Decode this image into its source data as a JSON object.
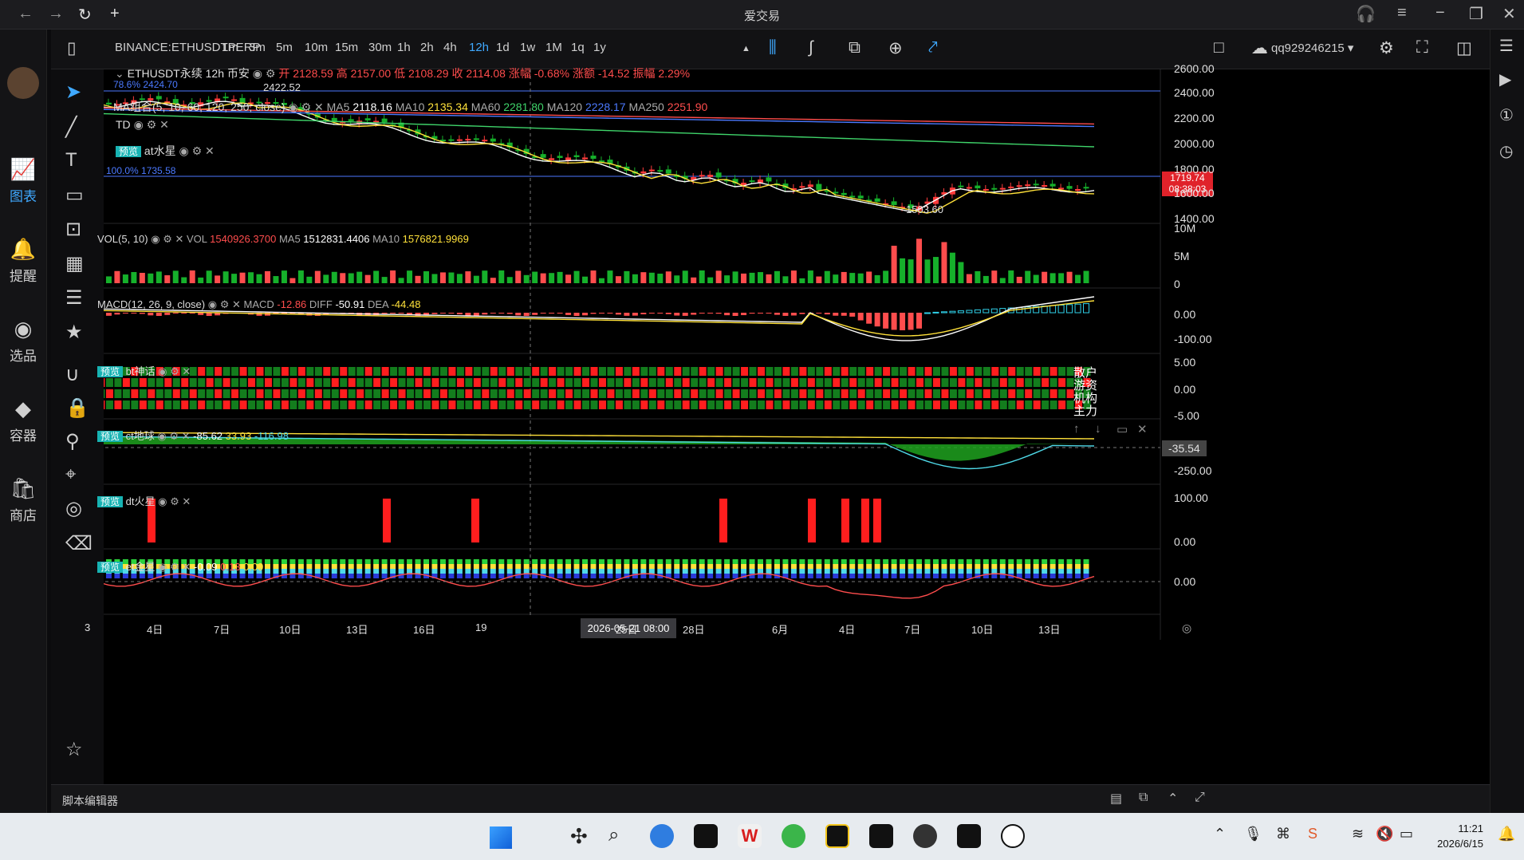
{
  "window": {
    "title": "爱交易"
  },
  "leftnav": [
    {
      "label": "图表",
      "icon": "chart-icon",
      "active": true
    },
    {
      "label": "提醒",
      "icon": "bell-icon",
      "active": false
    },
    {
      "label": "选品",
      "icon": "analytics-icon",
      "active": false
    },
    {
      "label": "容器",
      "icon": "container-icon",
      "active": false
    },
    {
      "label": "商店",
      "icon": "shop-icon",
      "active": false
    }
  ],
  "toolbar": {
    "symbol": "BINANCE:ETHUSDTPERP",
    "intervals": [
      "1m",
      "3m",
      "5m",
      "10m",
      "15m",
      "30m",
      "1h",
      "2h",
      "4h",
      "12h",
      "1d",
      "1w",
      "1M",
      "1q",
      "1y"
    ],
    "active_interval": "12h",
    "user": "qq929246215"
  },
  "main_legend": {
    "title": "ETHUSDT永续  12h  币安",
    "ohlc": "开 2128.59 高 2157.00 低 2108.29 收 2114.08 涨幅 -0.68% 涨额 -14.52 振幅 2.29%",
    "fib_top": "78.6% 2424.70",
    "high_label": "2422.52",
    "fib_mid": "100.0% 1735.58",
    "low_label": "1503.60",
    "price_tag": "1719.74",
    "countdown": "08:38:03"
  },
  "ma_legend": {
    "name": "MA组合(5, 10, 60, 120, 250, close)",
    "items": [
      {
        "k": "MA5",
        "v": "2118.16",
        "color": "#ffffff"
      },
      {
        "k": "MA10",
        "v": "2135.34",
        "color": "#ffe13a"
      },
      {
        "k": "MA60",
        "v": "2281.80",
        "color": "#3fd46a"
      },
      {
        "k": "MA120",
        "v": "2228.17",
        "color": "#4b79ff"
      },
      {
        "k": "MA250",
        "v": "2251.90",
        "color": "#ff4d4d"
      }
    ]
  },
  "td_legend": "TD",
  "at_legend": {
    "badge": "预览",
    "name": "at水星"
  },
  "price_axis": [
    "2600.00",
    "2400.00",
    "2200.00",
    "2000.00",
    "1800.00",
    "1600.00",
    "1400.00"
  ],
  "vol": {
    "name": "VOL(5, 10)",
    "vol": "1540926.3700",
    "ma5": "1512831.4406",
    "ma10": "1576821.9969",
    "axis": [
      "10M",
      "5M",
      "0"
    ]
  },
  "macd": {
    "name": "MACD(12, 26, 9, close)",
    "macd": "-12.86",
    "diff": "-50.91",
    "dea": "-44.48",
    "axis": [
      "0.00",
      "-100.00"
    ]
  },
  "bt": {
    "badge": "预览",
    "name": "bt神话",
    "axis": [
      "5.00",
      "0.00",
      "-5.00"
    ],
    "labels": [
      "散户",
      "游资",
      "机构",
      "主力"
    ]
  },
  "ct": {
    "badge": "预览",
    "name": "ct地球",
    "v1": "-85.62",
    "v2": "33.93",
    "v3": "-116.98",
    "axis": [
      "-35.54",
      "-250.00"
    ]
  },
  "dt": {
    "badge": "预览",
    "name": "dt火星",
    "axis": [
      "100.00",
      "0.00"
    ]
  },
  "et": {
    "badge": "预览",
    "name": "et金星",
    "v1": "-0.09",
    "v2": "0.13",
    "v3": "0.09",
    "axis": [
      "0.00"
    ]
  },
  "time_axis": [
    "3",
    "4日",
    "7日",
    "10日",
    "13日",
    "16日",
    "19",
    "25日",
    "28日",
    "6月",
    "4日",
    "7日",
    "10日",
    "13日"
  ],
  "crosshair_time": "2026-05-21  08:00",
  "bottombar": {
    "label": "脚本编辑器"
  },
  "taskbar": {
    "time": "11:21",
    "date": "2026/6/15"
  }
}
